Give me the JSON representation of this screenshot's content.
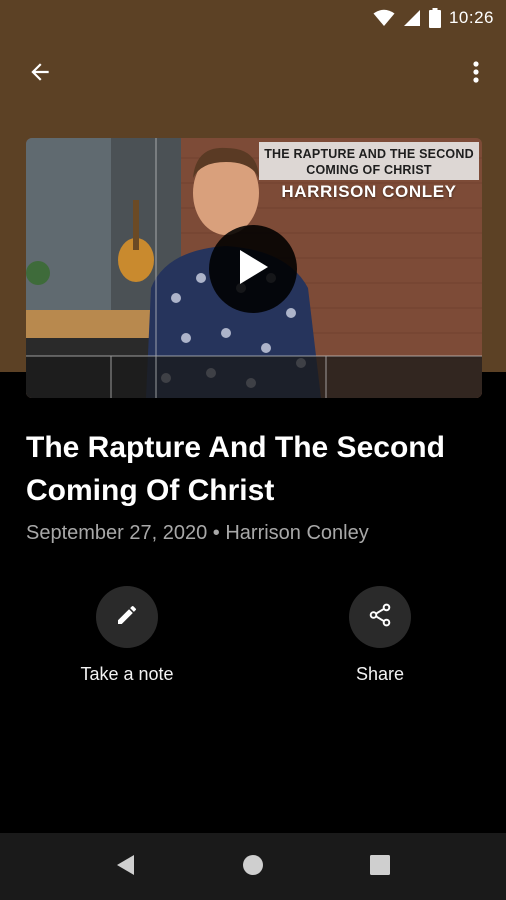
{
  "status_bar": {
    "time": "10:26",
    "icons": [
      "wifi-icon",
      "signal-icon",
      "battery-icon"
    ]
  },
  "app_bar": {
    "back_icon": "arrow-back-icon",
    "menu_icon": "more-vert-icon"
  },
  "video": {
    "thumbnail_title": "THE RAPTURE AND THE SECOND COMING OF CHRIST",
    "thumbnail_speaker": "HARRISON CONLEY",
    "play_icon": "play-icon"
  },
  "content": {
    "title": "The Rapture And The Second Coming Of Christ",
    "meta": "September 27, 2020 • Harrison Conley"
  },
  "actions": [
    {
      "label": "Take a note",
      "icon": "pencil-icon"
    },
    {
      "label": "Share",
      "icon": "share-icon"
    }
  ],
  "nav": {
    "icons": [
      "nav-back-icon",
      "nav-home-icon",
      "nav-recents-icon"
    ]
  },
  "colors": {
    "header_brown": "#5c4125",
    "background": "#000000",
    "meta_gray": "#a8a8a8",
    "action_circle": "#2a2a2a",
    "nav_bar": "#1a1a1a"
  }
}
